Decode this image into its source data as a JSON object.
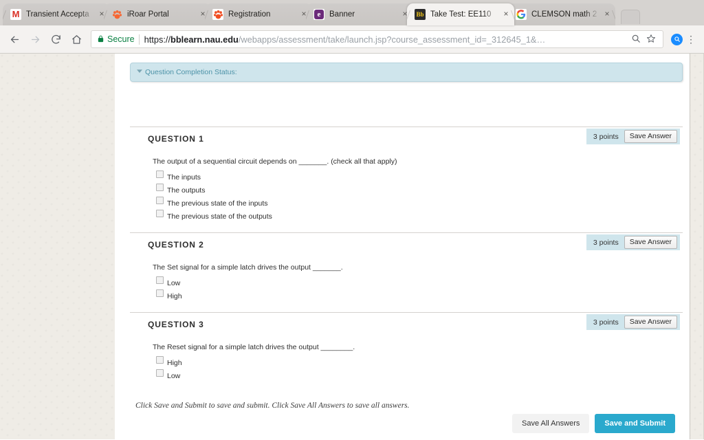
{
  "browser": {
    "tabs": [
      {
        "title": "Transient Accepta",
        "favicon": "gmail-icon",
        "active": false,
        "close_label": "×"
      },
      {
        "title": "iRoar Portal",
        "favicon": "paw-icon",
        "active": false,
        "close_label": "×"
      },
      {
        "title": "Registration",
        "favicon": "paw-icon",
        "active": false,
        "close_label": "×"
      },
      {
        "title": "Banner",
        "favicon": "edge-e-icon",
        "active": false,
        "close_label": "×"
      },
      {
        "title": "Take Test: EE110",
        "favicon": "blackboard-icon",
        "active": true,
        "close_label": "×"
      },
      {
        "title": "CLEMSON math 2",
        "favicon": "google-icon",
        "active": false,
        "close_label": "×"
      }
    ],
    "new_tab_label": "",
    "nav": {
      "back": "←",
      "forward": "→",
      "reload": "↻",
      "home": "⌂"
    },
    "omnibox": {
      "security_label": "Secure",
      "url_scheme": "https://",
      "url_host": "bblearn.nau.edu",
      "url_path": "/webapps/assessment/take/launch.jsp?course_assessment_id=_312645_1&…",
      "search_icon": "⚲",
      "bookmark_icon": "☆",
      "extension_icon": "⚲",
      "menu_icon": "⋮"
    }
  },
  "page": {
    "status_bar": {
      "chevron": "▼",
      "label": "Question Completion Status:"
    },
    "questions": [
      {
        "title": "QUESTION 1",
        "points": "3 points",
        "save_label": "Save Answer",
        "text": "The output of a sequential circuit depends on _______. (check all that apply)",
        "options": [
          "The inputs",
          "The outputs",
          "The previous state of the inputs",
          "The previous state of the outputs"
        ]
      },
      {
        "title": "QUESTION 2",
        "points": "3 points",
        "save_label": "Save Answer",
        "text": "The Set signal for a simple latch drives the output _______.",
        "options": [
          "Low",
          "High"
        ]
      },
      {
        "title": "QUESTION 3",
        "points": "3 points",
        "save_label": "Save Answer",
        "text": "The Reset signal for a simple latch drives the output ________.",
        "options": [
          "High",
          "Low"
        ]
      }
    ],
    "footer": {
      "note": "Click Save and Submit to save and submit. Click Save All Answers to save all answers.",
      "save_all_label": "Save All Answers",
      "submit_label": "Save and Submit"
    }
  },
  "colors": {
    "accent_teal": "#2aa9cd",
    "status_bg": "#cfe5ec",
    "secure_green": "#0b8043",
    "page_bg": "#efece6"
  }
}
